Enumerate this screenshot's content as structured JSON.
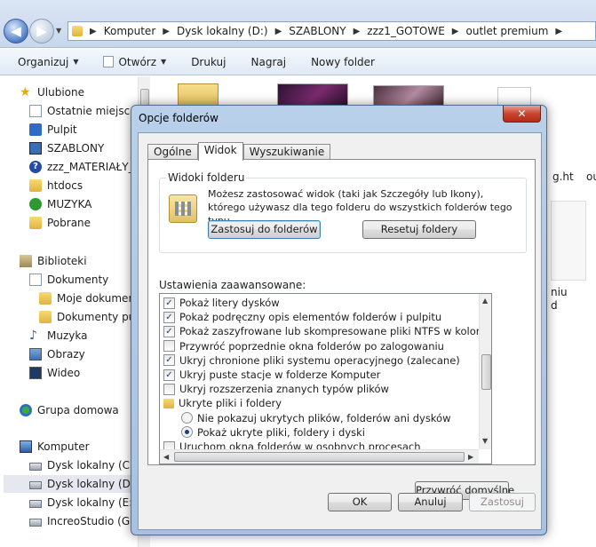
{
  "address": {
    "crumbs": [
      "Komputer",
      "Dysk lokalny (D:)",
      "SZABLONY",
      "zzz1_GOTOWE",
      "outlet premium"
    ]
  },
  "toolbar": {
    "organize": "Organizuj",
    "open": "Otwórz",
    "print": "Drukuj",
    "burn": "Nagraj",
    "new_folder": "Nowy folder"
  },
  "nav": {
    "favorites": "Ulubione",
    "recent": "Ostatnie miejsca",
    "desktop": "Pulpit",
    "szablony": "SZABLONY",
    "materialy": "zzz_MATERIAŁY_F",
    "htdocs": "htdocs",
    "muzyka_fav": "MUZYKA",
    "downloads": "Pobrane",
    "libraries": "Biblioteki",
    "documents": "Dokumenty",
    "my_documents": "Moje dokument",
    "public_documents": "Dokumenty pub",
    "music": "Muzyka",
    "pictures": "Obrazy",
    "videos": "Wideo",
    "homegroup": "Grupa domowa",
    "computer": "Komputer",
    "drive_c": "Dysk lokalny (C:)",
    "drive_d": "Dysk lokalny (D:)",
    "drive_e": "Dysk lokalny (E:)",
    "drive_g": "IncreoStudio (G:)"
  },
  "files": {
    "partial1": "g.ht",
    "partial2": "ou",
    "partial3": "niu",
    "partial4": "d"
  },
  "dialog": {
    "title": "Opcje folderów",
    "close": "✕",
    "tabs": [
      "Ogólne",
      "Widok",
      "Wyszukiwanie"
    ],
    "folder_views": {
      "title": "Widoki folderu",
      "description": "Możesz zastosować widok (taki jak Szczegóły lub Ikony), którego używasz dla tego folderu do wszystkich folderów tego typu.",
      "apply_button": "Zastosuj do folderów",
      "reset_button": "Resetuj foldery"
    },
    "advanced_label": "Ustawienia zaawansowane:",
    "advanced_items": [
      {
        "type": "checkbox",
        "checked": true,
        "label": "Pokaż litery dysków"
      },
      {
        "type": "checkbox",
        "checked": true,
        "label": "Pokaż podręczny opis elementów folderów i pulpitu"
      },
      {
        "type": "checkbox",
        "checked": true,
        "label": "Pokaż zaszyfrowane lub skompresowane pliki NTFS w kolorze"
      },
      {
        "type": "checkbox",
        "checked": false,
        "label": "Przywróć poprzednie okna folderów po zalogowaniu"
      },
      {
        "type": "checkbox",
        "checked": true,
        "label": "Ukryj chronione pliki systemu operacyjnego (zalecane)"
      },
      {
        "type": "checkbox",
        "checked": true,
        "label": "Ukryj puste stacje w folderze Komputer"
      },
      {
        "type": "checkbox",
        "checked": false,
        "label": "Ukryj rozszerzenia znanych typów plików"
      },
      {
        "type": "folder",
        "label": "Ukryte pliki i foldery"
      },
      {
        "type": "radio",
        "checked": false,
        "label": "Nie pokazuj ukrytych plików, folderów ani dysków"
      },
      {
        "type": "radio",
        "checked": true,
        "label": "Pokaż ukryte pliki, foldery i dyski"
      },
      {
        "type": "checkbox",
        "checked": false,
        "label": "Uruchom okna folderów w osobnych procesach"
      }
    ],
    "restore_defaults": "Przywróć domyślne",
    "ok": "OK",
    "cancel": "Anuluj",
    "apply": "Zastosuj"
  }
}
